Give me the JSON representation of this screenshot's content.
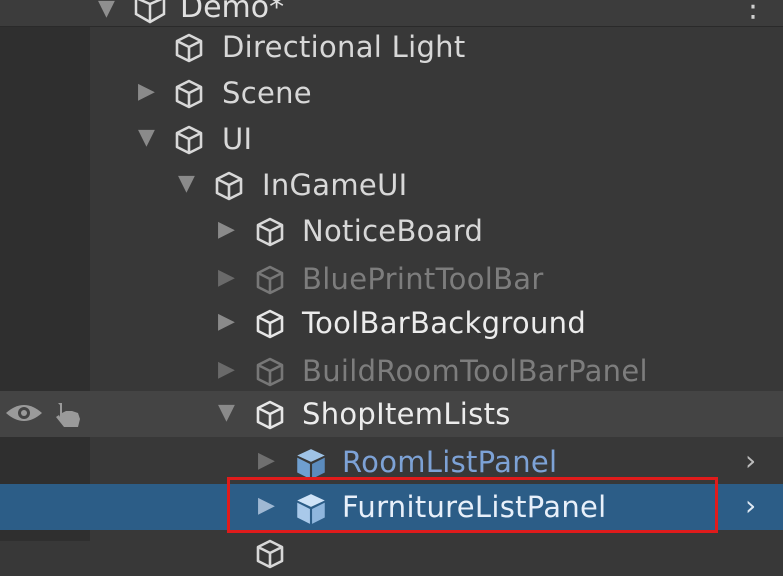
{
  "hierarchy": {
    "scene_name": "Demo*",
    "items": [
      {
        "label": "Directional Light",
        "style": "normal",
        "icon": "gameobject-icon",
        "expanded": null
      },
      {
        "label": "Scene",
        "style": "normal",
        "icon": "gameobject-icon",
        "expanded": false
      },
      {
        "label": "UI",
        "style": "normal",
        "icon": "gameobject-icon",
        "expanded": true
      },
      {
        "label": "InGameUI",
        "style": "normal",
        "icon": "gameobject-icon",
        "expanded": true
      },
      {
        "label": "NoticeBoard",
        "style": "normal",
        "icon": "gameobject-icon",
        "expanded": false
      },
      {
        "label": "BluePrintToolBar",
        "style": "inactive",
        "icon": "gameobject-icon",
        "expanded": false
      },
      {
        "label": "ToolBarBackground",
        "style": "normal",
        "icon": "gameobject-icon",
        "expanded": false
      },
      {
        "label": "BuildRoomToolBarPanel",
        "style": "inactive",
        "icon": "gameobject-icon",
        "expanded": false
      },
      {
        "label": "ShopItemLists",
        "style": "normal",
        "icon": "gameobject-icon",
        "expanded": true
      },
      {
        "label": "RoomListPanel",
        "style": "prefab",
        "icon": "prefab-icon",
        "expanded": false
      },
      {
        "label": "FurnitureListPanel",
        "style": "prefab-selected",
        "icon": "prefab-icon",
        "expanded": false
      }
    ]
  },
  "colors": {
    "background": "#383838",
    "selection": "#2c5d87",
    "prefab_text": "#7da2d6",
    "highlight_border": "#e01b1b"
  }
}
